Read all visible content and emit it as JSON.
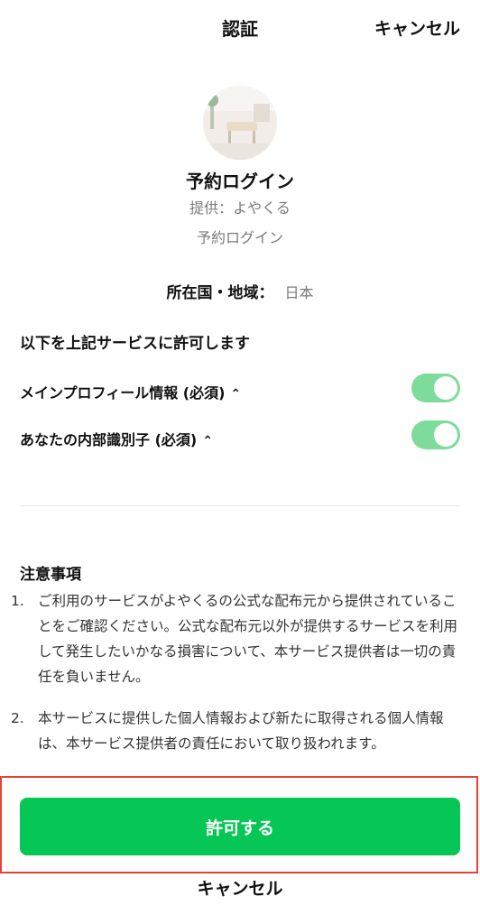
{
  "header": {
    "title": "認証",
    "cancel_label": "キャンセル"
  },
  "app": {
    "name": "予約ログイン",
    "provider": "提供：よやくる",
    "service_name": "予約ログイン"
  },
  "region": {
    "label": "所在国・地域：",
    "value": "日本"
  },
  "permissions": {
    "heading": "以下を上記サービスに許可します",
    "items": [
      {
        "label": "メインプロフィール情報 (必須)",
        "enabled": true
      },
      {
        "label": "あなたの内部識別子 (必須)",
        "enabled": true
      }
    ]
  },
  "notes": {
    "title": "注意事項",
    "items": [
      {
        "num": "1.",
        "text": "ご利用のサービスがよやくるの公式な配布元から提供されていることをご確認ください。公式な配布元以外が提供するサービスを利用して発生したいかなる損害について、本サービス提供者は一切の責任を負いません。"
      },
      {
        "num": "2.",
        "text": "本サービスに提供した個人情報および新たに取得される個人情報は、本サービス提供者の責任において取り扱われます。"
      }
    ]
  },
  "actions": {
    "allow_label": "許可する",
    "cancel_label": "キャンセル"
  },
  "colors": {
    "accent": "#06c755",
    "toggle_on": "#7ddc9c",
    "highlight_border": "#e0443b"
  }
}
